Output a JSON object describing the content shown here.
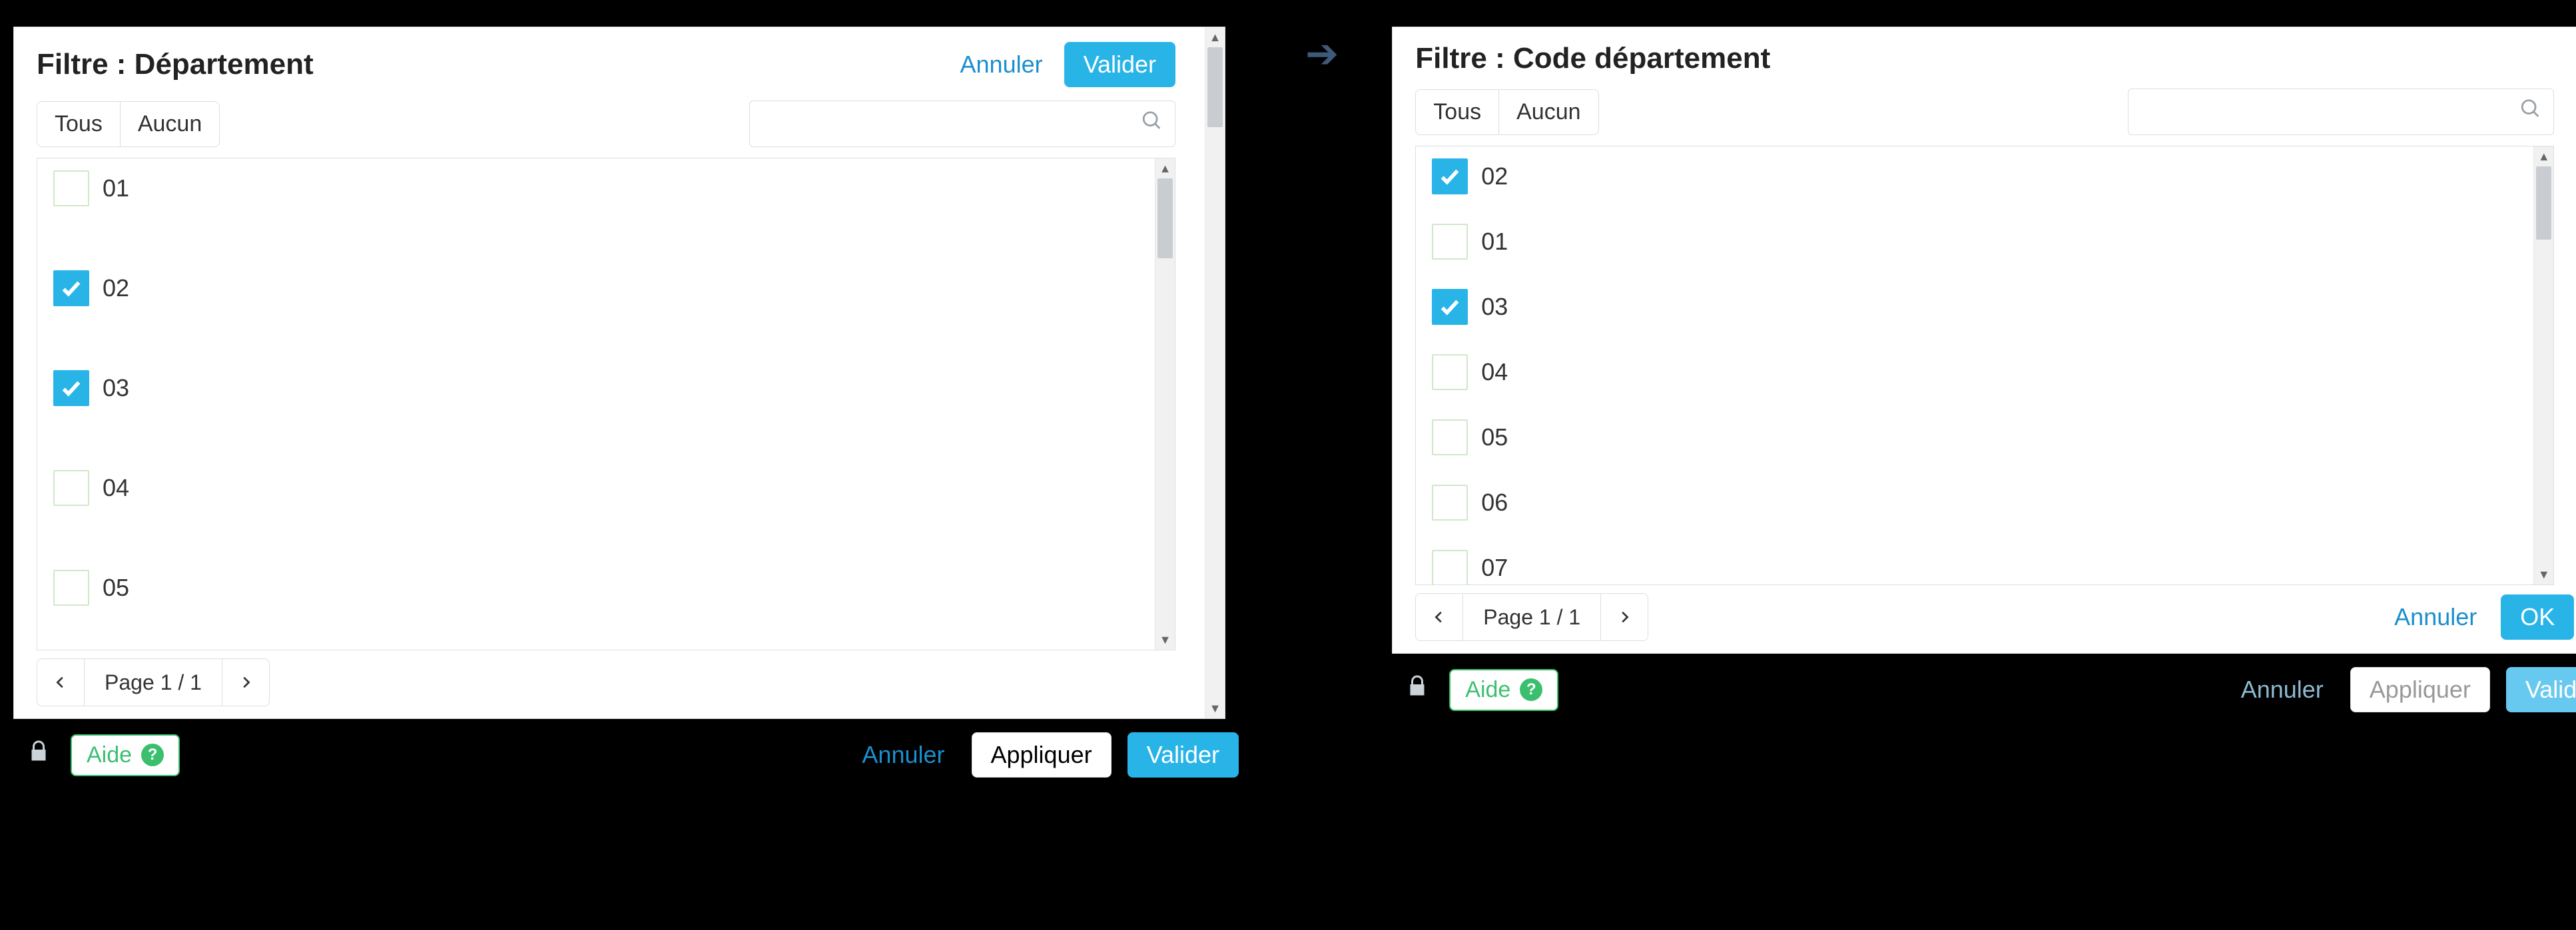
{
  "left": {
    "title": "Filtre : Département",
    "cancel": "Annuler",
    "ok": "Valider",
    "all": "Tous",
    "none": "Aucun",
    "searchPlaceholder": "",
    "items": [
      {
        "label": "01",
        "checked": false
      },
      {
        "label": "02",
        "checked": true
      },
      {
        "label": "03",
        "checked": true
      },
      {
        "label": "04",
        "checked": false
      },
      {
        "label": "05",
        "checked": false
      }
    ],
    "pager": "Page 1 / 1",
    "footer": {
      "help": "Aide",
      "cancel": "Annuler",
      "apply": "Appliquer",
      "ok": "Valider"
    }
  },
  "right": {
    "title": "Filtre : Code département",
    "all": "Tous",
    "none": "Aucun",
    "searchPlaceholder": "",
    "items": [
      {
        "label": "02",
        "checked": true
      },
      {
        "label": "01",
        "checked": false
      },
      {
        "label": "03",
        "checked": true
      },
      {
        "label": "04",
        "checked": false
      },
      {
        "label": "05",
        "checked": false
      },
      {
        "label": "06",
        "checked": false
      },
      {
        "label": "07",
        "checked": false
      }
    ],
    "pager": "Page 1 / 1",
    "cancel": "Annuler",
    "ok": "OK",
    "footer": {
      "help": "Aide",
      "cancel": "Annuler",
      "apply": "Appliquer",
      "ok": "Valider"
    }
  }
}
